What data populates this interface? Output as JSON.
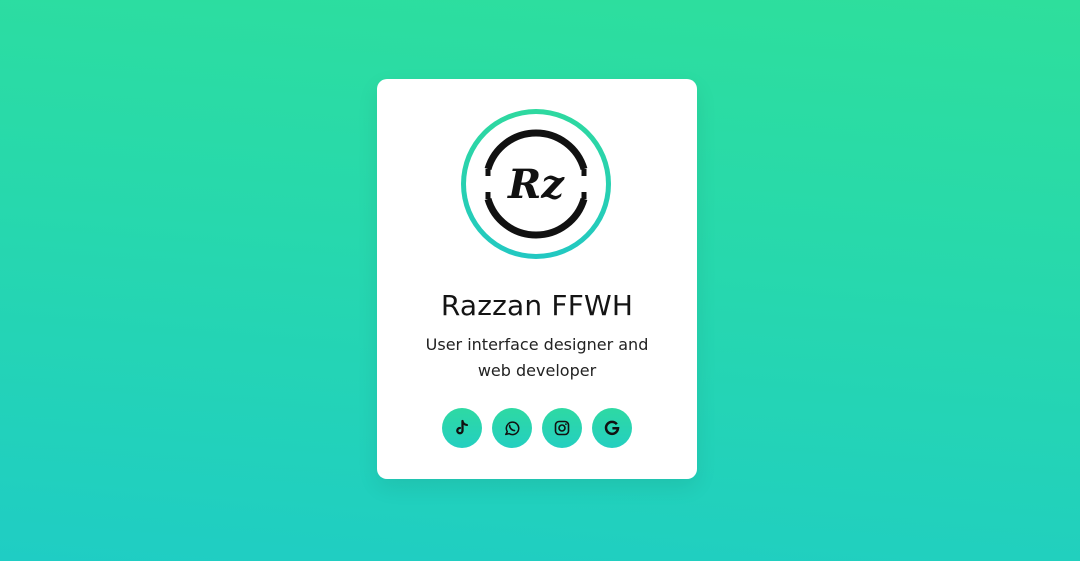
{
  "profile": {
    "logo_text": "Rz",
    "name": "Razzan FFWH",
    "role": "User interface designer and web developer"
  },
  "socials": [
    {
      "icon": "tiktok-icon"
    },
    {
      "icon": "whatsapp-icon"
    },
    {
      "icon": "instagram-icon"
    },
    {
      "icon": "google-icon"
    }
  ],
  "colors": {
    "background_top": "#2edf9c",
    "background_bottom": "#1fcdc4",
    "accent": "#27d6b0",
    "card": "#ffffff",
    "text": "#141414"
  }
}
